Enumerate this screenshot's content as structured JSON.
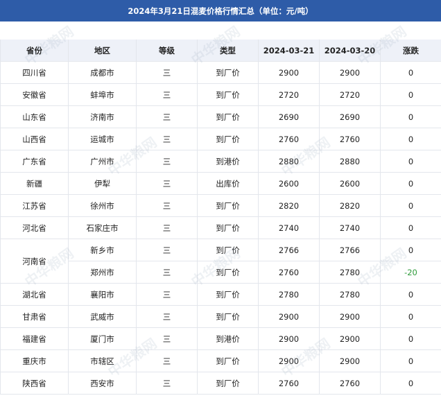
{
  "title": "2024年3月21日混麦价格行情汇总（单位：元/吨）",
  "headers": [
    "省份",
    "地区",
    "等级",
    "类型",
    "2024-03-21",
    "2024-03-20",
    "涨跌"
  ],
  "rows": [
    {
      "province": "四川省",
      "city": "成都市",
      "grade": "三",
      "type": "到厂价",
      "p1": "2900",
      "p2": "2900",
      "change": "0"
    },
    {
      "province": "安徽省",
      "city": "蚌埠市",
      "grade": "三",
      "type": "到厂价",
      "p1": "2720",
      "p2": "2720",
      "change": "0"
    },
    {
      "province": "山东省",
      "city": "济南市",
      "grade": "三",
      "type": "到厂价",
      "p1": "2690",
      "p2": "2690",
      "change": "0"
    },
    {
      "province": "山西省",
      "city": "运城市",
      "grade": "三",
      "type": "到厂价",
      "p1": "2760",
      "p2": "2760",
      "change": "0"
    },
    {
      "province": "广东省",
      "city": "广州市",
      "grade": "三",
      "type": "到港价",
      "p1": "2880",
      "p2": "2880",
      "change": "0"
    },
    {
      "province": "新疆",
      "city": "伊犁",
      "grade": "三",
      "type": "出库价",
      "p1": "2600",
      "p2": "2600",
      "change": "0"
    },
    {
      "province": "江苏省",
      "city": "徐州市",
      "grade": "三",
      "type": "到厂价",
      "p1": "2820",
      "p2": "2820",
      "change": "0"
    },
    {
      "province": "河北省",
      "city": "石家庄市",
      "grade": "三",
      "type": "到厂价",
      "p1": "2740",
      "p2": "2740",
      "change": "0"
    },
    {
      "province": "河南省",
      "city": "新乡市",
      "grade": "三",
      "type": "到厂价",
      "p1": "2766",
      "p2": "2766",
      "change": "0"
    },
    {
      "province": "",
      "city": "郑州市",
      "grade": "三",
      "type": "到厂价",
      "p1": "2760",
      "p2": "2780",
      "change": "-20"
    },
    {
      "province": "湖北省",
      "city": "襄阳市",
      "grade": "三",
      "type": "到厂价",
      "p1": "2780",
      "p2": "2780",
      "change": "0"
    },
    {
      "province": "甘肃省",
      "city": "武威市",
      "grade": "三",
      "type": "到厂价",
      "p1": "2900",
      "p2": "2900",
      "change": "0"
    },
    {
      "province": "福建省",
      "city": "厦门市",
      "grade": "三",
      "type": "到港价",
      "p1": "2900",
      "p2": "2900",
      "change": "0"
    },
    {
      "province": "重庆市",
      "city": "市辖区",
      "grade": "三",
      "type": "到厂价",
      "p1": "2900",
      "p2": "2900",
      "change": "0"
    },
    {
      "province": "陕西省",
      "city": "西安市",
      "grade": "三",
      "type": "到厂价",
      "p1": "2760",
      "p2": "2760",
      "change": "0"
    }
  ],
  "watermark_text": "中华粮网",
  "colors": {
    "header_bg": "#2e5ca8",
    "column_header_bg": "#eef1f8",
    "negative": "#2e9b3a"
  }
}
